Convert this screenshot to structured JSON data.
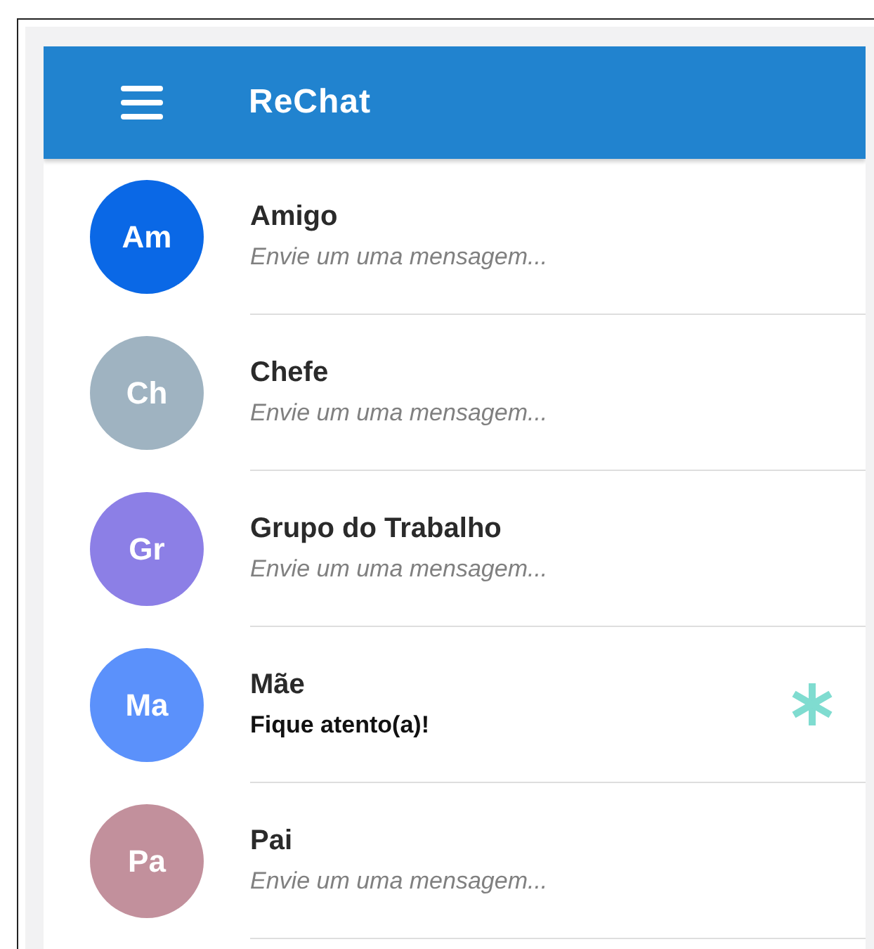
{
  "app_bar": {
    "title": "ReChat"
  },
  "chats": [
    {
      "initials": "Am",
      "color": "#0a68e6",
      "name": "Amigo",
      "message": "Envie um uma mensagem...",
      "unread": false
    },
    {
      "initials": "Ch",
      "color": "#9fb3c1",
      "name": "Chefe",
      "message": "Envie um uma mensagem...",
      "unread": false
    },
    {
      "initials": "Gr",
      "color": "#8c7fe6",
      "name": "Grupo do Trabalho",
      "message": "Envie um uma mensagem...",
      "unread": false
    },
    {
      "initials": "Ma",
      "color": "#5b91fb",
      "name": "Mãe",
      "message": "Fique atento(a)!",
      "unread": true
    },
    {
      "initials": "Pa",
      "color": "#c2909c",
      "name": "Pai",
      "message": "Envie um uma mensagem...",
      "unread": false
    }
  ]
}
